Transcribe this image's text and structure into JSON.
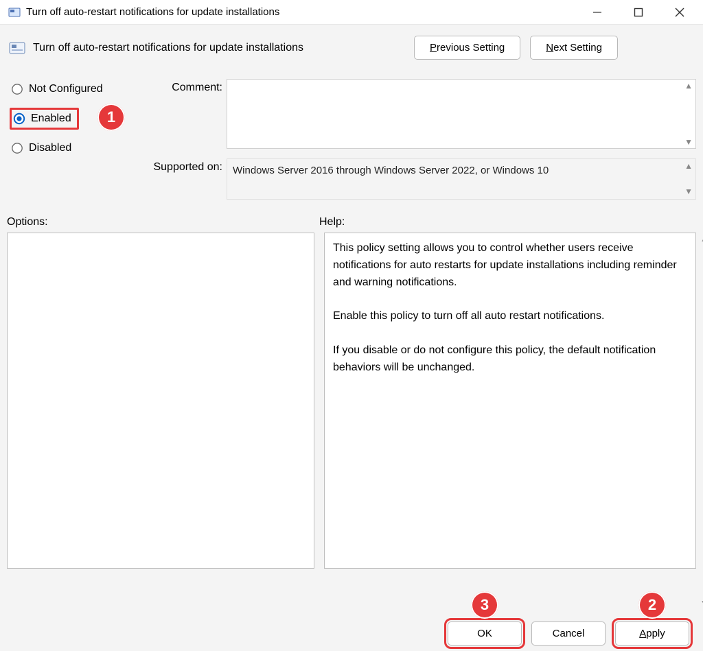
{
  "window": {
    "title": "Turn off auto-restart notifications for update installations",
    "minimize_name": "minimize-icon",
    "maximize_name": "maximize-icon",
    "close_name": "close-icon"
  },
  "header": {
    "title": "Turn off auto-restart notifications for update installations",
    "prev_prefix": "P",
    "prev_rest": "revious Setting",
    "next_prefix": "N",
    "next_rest": "ext Setting"
  },
  "state": {
    "not_configured": {
      "prefix": "Not ",
      "ul": "C",
      "suffix": "onfigured",
      "checked": false
    },
    "enabled": {
      "prefix": "",
      "ul": "E",
      "suffix": "nabled",
      "checked": true
    },
    "disabled": {
      "prefix": "",
      "ul": "D",
      "suffix": "isabled",
      "checked": false
    }
  },
  "labels": {
    "comment": "Comment:",
    "supported": "Supported on:",
    "options": "Options:",
    "help": "Help:"
  },
  "fields": {
    "comment": "",
    "supported": "Windows Server 2016 through Windows Server 2022, or Windows 10"
  },
  "help_text": "This policy setting allows you to control whether users receive notifications for auto restarts for update installations including reminder and warning notifications.\n\nEnable this policy to turn off all auto restart notifications.\n\nIf you disable or do not configure this policy, the default notification behaviors will be unchanged.",
  "footer": {
    "ok": "OK",
    "cancel": "Cancel",
    "apply_ul": "A",
    "apply_rest": "pply"
  },
  "annotations": {
    "b1": "1",
    "b2": "2",
    "b3": "3"
  }
}
